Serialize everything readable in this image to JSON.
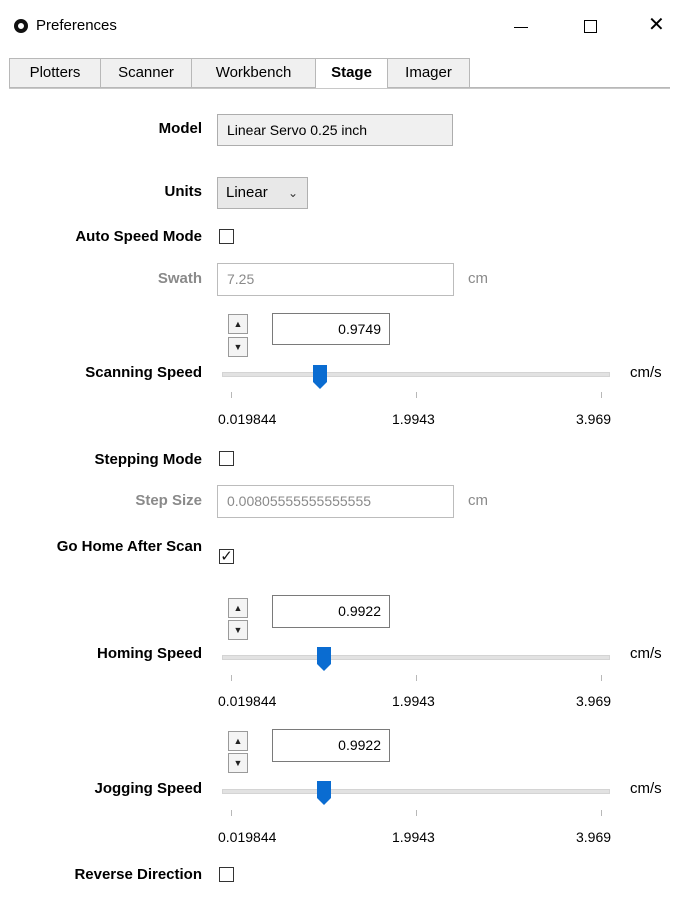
{
  "window": {
    "title": "Preferences",
    "minimize_label": "—",
    "maximize_label": "□",
    "close_label": "✕"
  },
  "tabs": [
    {
      "label": "Plotters",
      "active": false
    },
    {
      "label": "Scanner",
      "active": false
    },
    {
      "label": "Workbench",
      "active": false
    },
    {
      "label": "Stage",
      "active": true
    },
    {
      "label": "Imager",
      "active": false
    }
  ],
  "stage": {
    "model": {
      "label": "Model",
      "value": "Linear Servo 0.25 inch"
    },
    "units": {
      "label": "Units",
      "value": "Linear",
      "arrow": "⌄"
    },
    "auto_speed_mode": {
      "label": "Auto Speed Mode",
      "checked": false
    },
    "swath": {
      "label": "Swath",
      "value": "7.25",
      "unit": "cm"
    },
    "scanning_speed": {
      "label": "Scanning Speed",
      "value": "0.9749",
      "unit": "cm/s",
      "fraction": 0.24,
      "min_label": "0.019844",
      "mid_label": "1.9943",
      "max_label": "3.969"
    },
    "stepping_mode": {
      "label": "Stepping Mode",
      "checked": false
    },
    "step_size": {
      "label": "Step Size",
      "value": "0.00805555555555555",
      "unit": "cm"
    },
    "go_home_after_scan": {
      "label": "Go Home After Scan",
      "checked": true,
      "check_glyph": "✓"
    },
    "homing_speed": {
      "label": "Homing Speed",
      "value": "0.9922",
      "unit": "cm/s",
      "fraction": 0.25,
      "min_label": "0.019844",
      "mid_label": "1.9943",
      "max_label": "3.969"
    },
    "jogging_speed": {
      "label": "Jogging Speed",
      "value": "0.9922",
      "unit": "cm/s",
      "fraction": 0.25,
      "min_label": "0.019844",
      "mid_label": "1.9943",
      "max_label": "3.969"
    },
    "reverse_direction": {
      "label": "Reverse Direction",
      "checked": false
    }
  },
  "spin": {
    "up_glyph": "▲",
    "down_glyph": "▼"
  },
  "colors": {
    "accent": "#0a6cd1",
    "tab_border": "#b8b8b8",
    "disabled_text": "#8a8a8a"
  }
}
